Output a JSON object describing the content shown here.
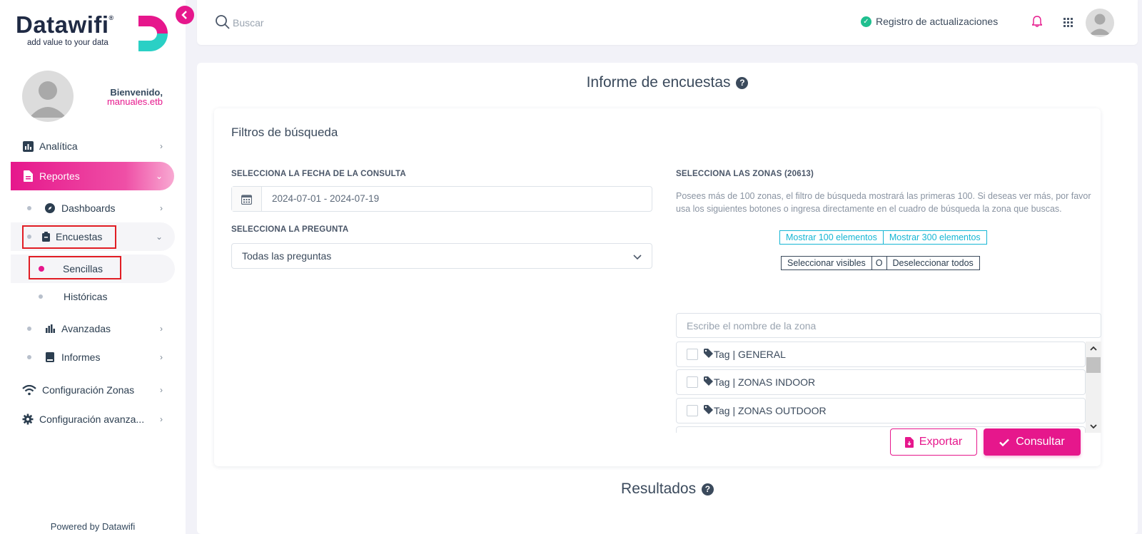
{
  "brand": {
    "name": "Datawifi",
    "registered": "®",
    "tagline": "add value to your data",
    "accent": "#e6178c",
    "teal": "#2ad0c5"
  },
  "user": {
    "welcome": "Bienvenido,",
    "name": "manuales.etb"
  },
  "sidebar": {
    "items": [
      {
        "label": "Analítica",
        "icon": "chart-bar-icon"
      },
      {
        "label": "Reportes",
        "icon": "file-icon",
        "active": true
      },
      {
        "label": "Dashboards",
        "icon": "compass-icon"
      },
      {
        "label": "Encuestas",
        "icon": "clipboard-icon"
      },
      {
        "label": "Sencillas",
        "active": true
      },
      {
        "label": "Históricas"
      },
      {
        "label": "Avanzadas",
        "icon": "bar-chart-icon"
      },
      {
        "label": "Informes",
        "icon": "book-icon"
      },
      {
        "label": "Configuración Zonas",
        "icon": "wifi-icon"
      },
      {
        "label": "Configuración avanza...",
        "icon": "gear-icon"
      }
    ],
    "footer": "Powered by Datawifi"
  },
  "topbar": {
    "search_placeholder": "Buscar",
    "updates_label": "Registro de actualizaciones"
  },
  "main": {
    "title": "Informe de encuestas",
    "help": "?",
    "filters": {
      "title": "Filtros de búsqueda",
      "date_label": "SELECCIONA LA FECHA DE LA CONSULTA",
      "date_value": "2024-07-01 - 2024-07-19",
      "question_label": "SELECCIONA LA PREGUNTA",
      "question_value": "Todas las preguntas",
      "zones_label": "SELECCIONA LAS ZONAS (20613)",
      "zones_desc": "Posees más de 100 zonas, el filtro de búsqueda mostrará las primeras 100. Si deseas ver más, por favor usa los siguientes botones o ingresa directamente en el cuadro de búsqueda la zona que buscas.",
      "show100": "Mostrar 100 elementos",
      "show300": "Mostrar 300 elementos",
      "select_visible": "Seleccionar visibles",
      "or": "O",
      "deselect_all": "Deseleccionar todos",
      "zone_search_placeholder": "Escribe el nombre de la zona",
      "zones": [
        "Tag | GENERAL",
        "Tag | ZONAS INDOOR",
        "Tag | ZONAS OUTDOOR"
      ],
      "export_label": "Exportar",
      "consult_label": "Consultar"
    },
    "results_title": "Resultados"
  }
}
